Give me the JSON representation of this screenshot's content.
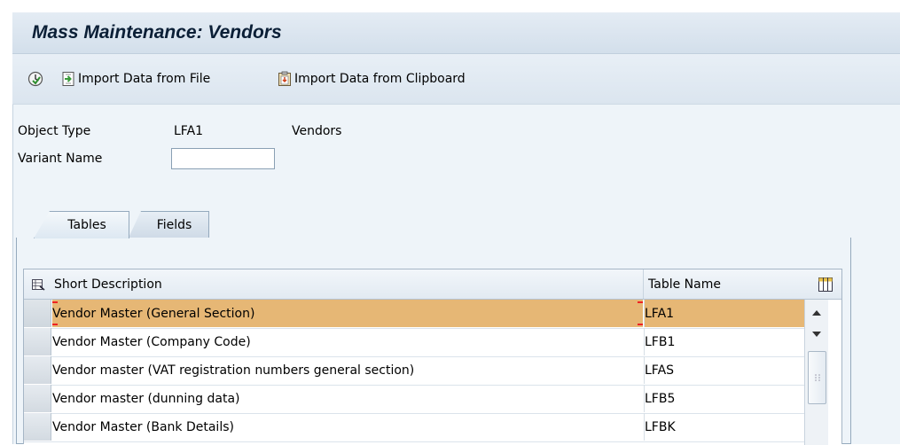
{
  "window": {
    "title": "Mass Maintenance: Vendors"
  },
  "toolbar": {
    "execute_icon": "execute-clock-icon",
    "import_file_label": "Import Data from File",
    "import_clipboard_label": "Import Data from Clipboard"
  },
  "form": {
    "object_type_label": "Object Type",
    "object_type_value": "LFA1",
    "object_type_desc": "Vendors",
    "variant_name_label": "Variant Name",
    "variant_name_value": ""
  },
  "tabs": [
    {
      "label": "Tables",
      "active": true
    },
    {
      "label": "Fields",
      "active": false
    }
  ],
  "table": {
    "columns": [
      "Short Description",
      "Table Name"
    ],
    "rows": [
      {
        "description": "Vendor Master (General Section)",
        "table_name": "LFA1",
        "selected": true
      },
      {
        "description": "Vendor Master (Company Code)",
        "table_name": "LFB1",
        "selected": false
      },
      {
        "description": "Vendor master (VAT registration numbers general section)",
        "table_name": "LFAS",
        "selected": false
      },
      {
        "description": "Vendor master (dunning data)",
        "table_name": "LFB5",
        "selected": false
      },
      {
        "description": "Vendor Master (Bank Details)",
        "table_name": "LFBK",
        "selected": false
      }
    ]
  },
  "colors": {
    "selected_row": "#e6b775",
    "background": "#eef4f9",
    "title_text": "#0b1f36"
  }
}
